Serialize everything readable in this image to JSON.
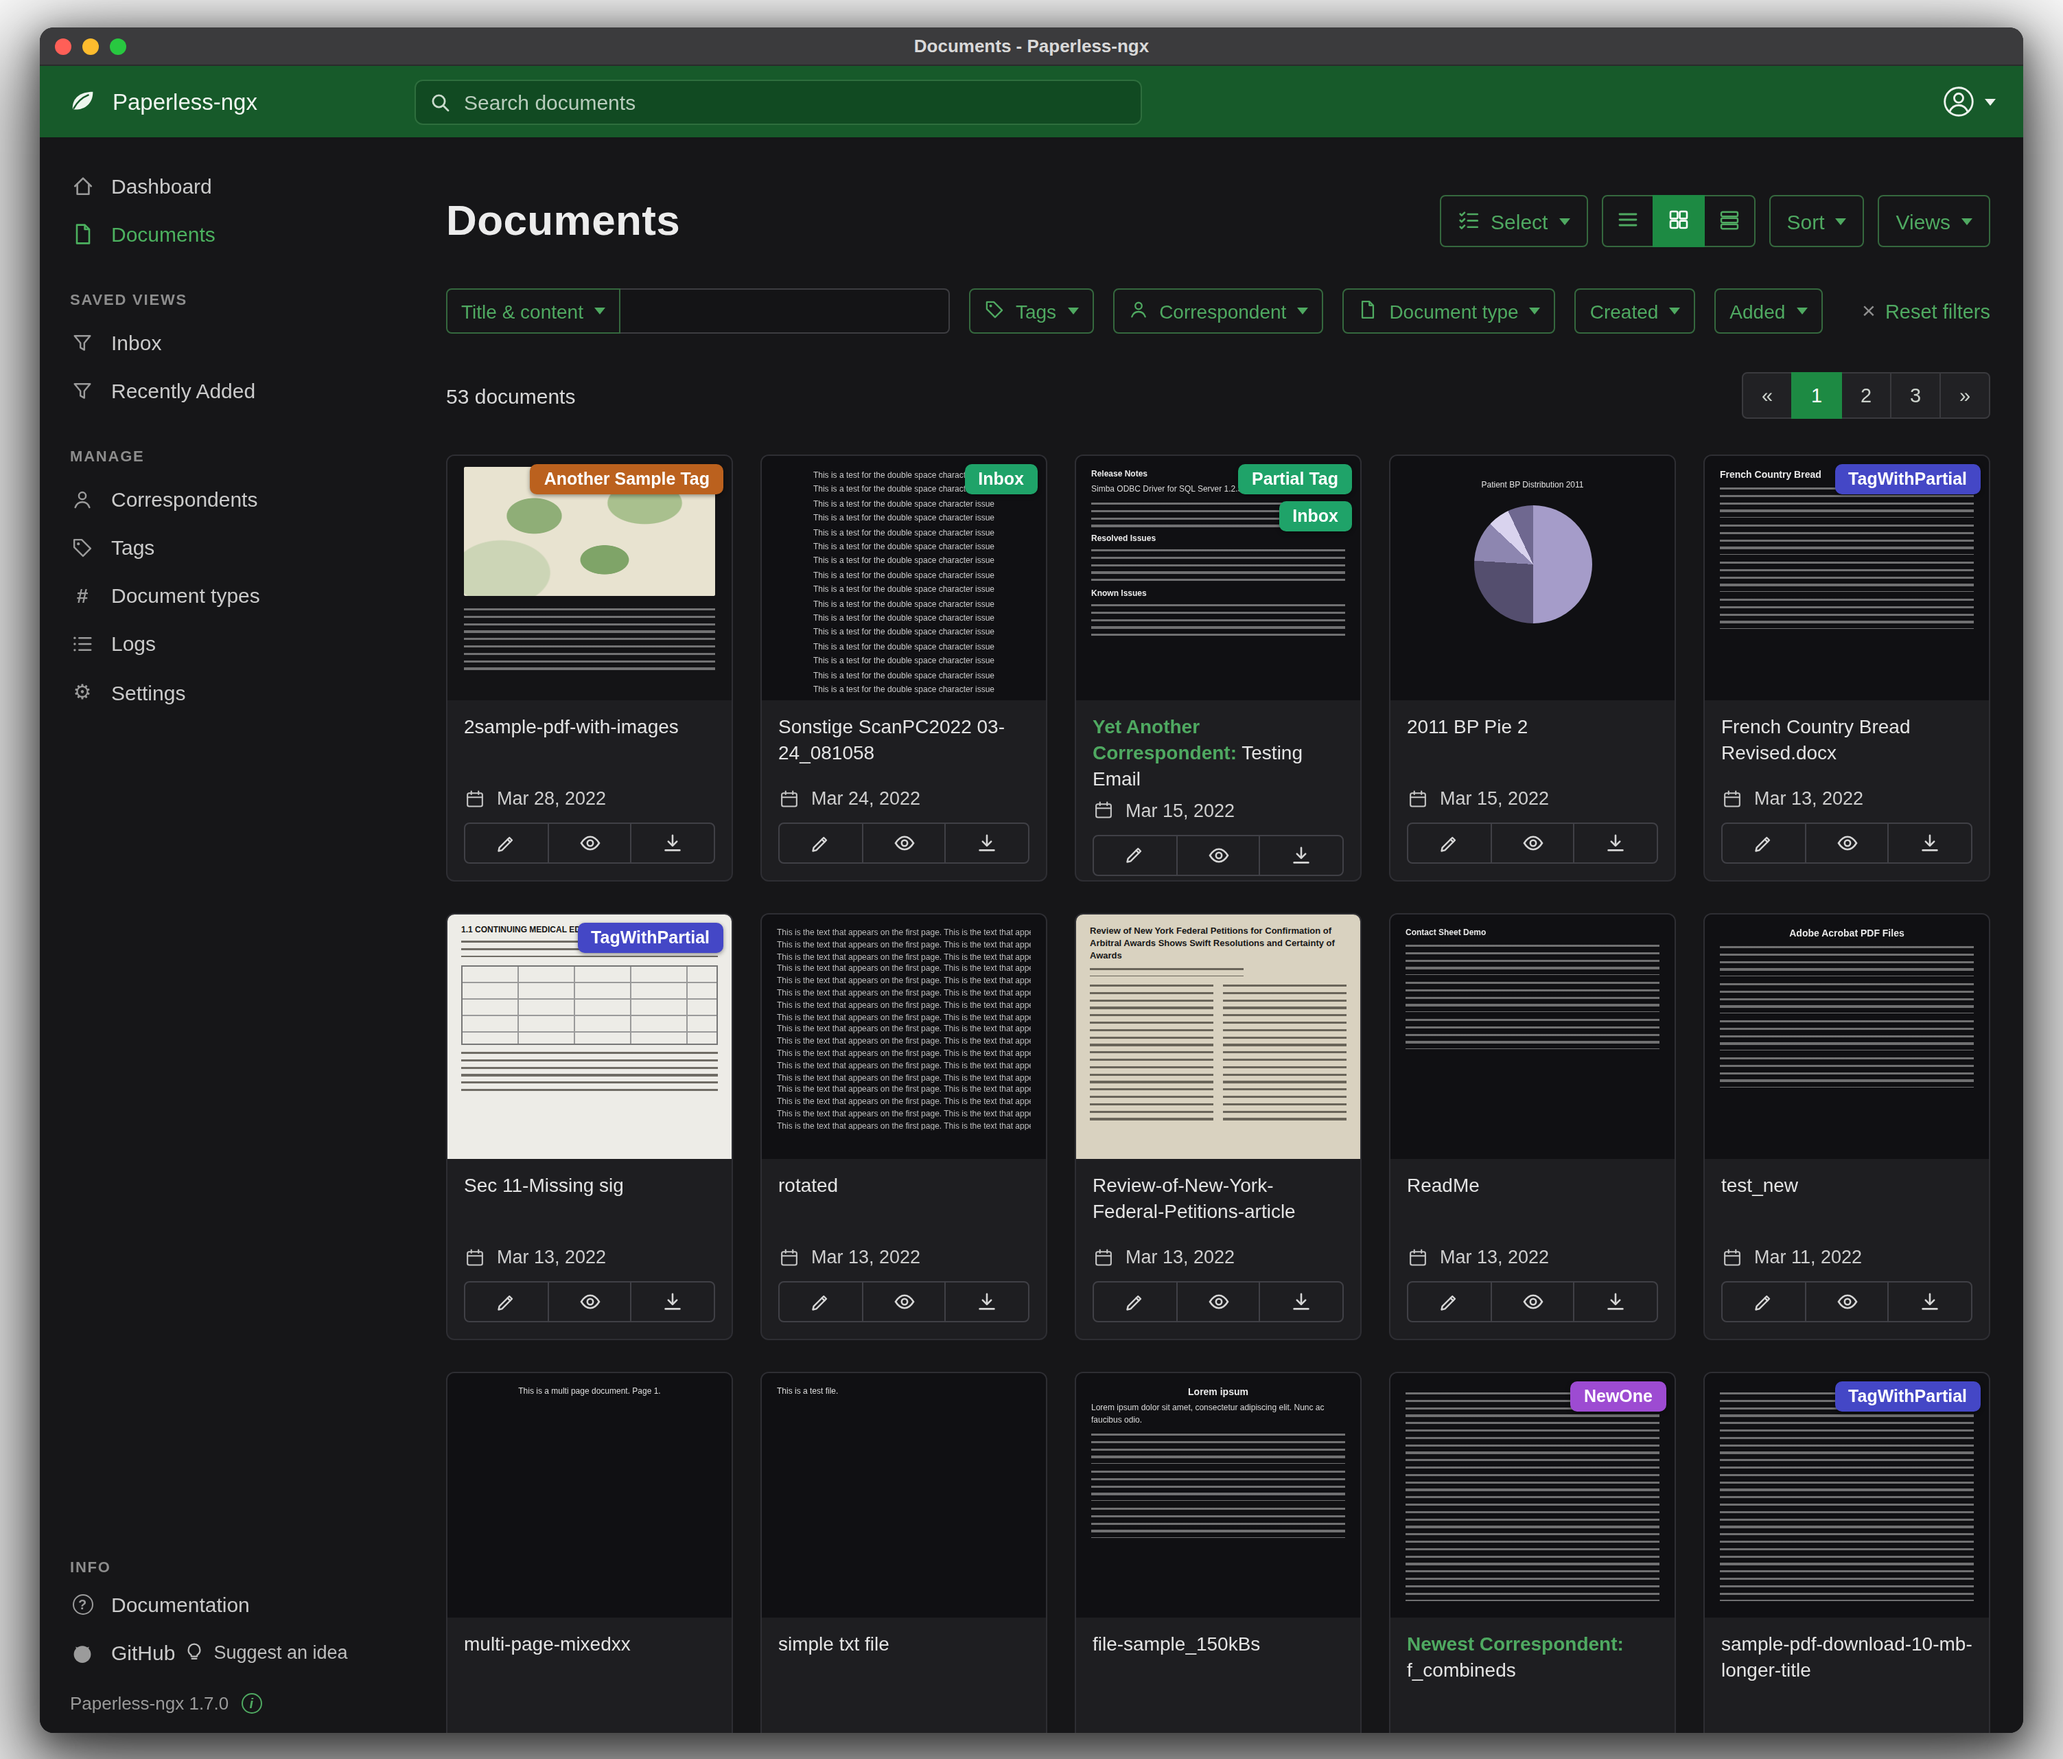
{
  "window": {
    "title": "Documents - Paperless-ngx"
  },
  "navbar": {
    "brand": "Paperless-ngx",
    "search_placeholder": "Search documents"
  },
  "sidebar": {
    "dashboard": "Dashboard",
    "documents": "Documents",
    "saved_views_title": "SAVED VIEWS",
    "inbox": "Inbox",
    "recently_added": "Recently Added",
    "manage_title": "MANAGE",
    "correspondents": "Correspondents",
    "tags": "Tags",
    "document_types": "Document types",
    "logs": "Logs",
    "settings": "Settings",
    "info_title": "INFO",
    "documentation": "Documentation",
    "github": "GitHub",
    "suggest": "Suggest an idea",
    "version": "Paperless-ngx 1.7.0"
  },
  "main": {
    "title": "Documents",
    "toolbar": {
      "select": "Select",
      "sort": "Sort",
      "views": "Views"
    },
    "filters": {
      "title_content": "Title & content",
      "tags": "Tags",
      "correspondent": "Correspondent",
      "document_type": "Document type",
      "created": "Created",
      "added": "Added",
      "reset": "Reset filters"
    },
    "count": "53 documents",
    "pagination": {
      "prev": "«",
      "pages": [
        "1",
        "2",
        "3"
      ],
      "next": "»",
      "active": "1"
    },
    "cards": [
      {
        "title": "2sample-pdf-with-images",
        "date": "Mar 28, 2022",
        "tags": [
          {
            "label": "Another Sample Tag",
            "color": "#bb611e"
          }
        ],
        "thumb": {
          "kind": "map"
        }
      },
      {
        "title": "Sonstige ScanPC2022 03-24_081058",
        "date": "Mar 24, 2022",
        "tags": [
          {
            "label": "Inbox",
            "color": "#1fa369"
          }
        ],
        "thumb": {
          "kind": "repeat",
          "text": "This is a test for the double space character issue",
          "count": 16,
          "align": "center"
        }
      },
      {
        "correspondent": "Yet Another Correspondent",
        "title": "Testing Email",
        "date": "Mar 15, 2022",
        "tags": [
          {
            "label": "Partial Tag",
            "color": "#1fa369"
          },
          {
            "label": "Inbox",
            "color": "#1fa369"
          }
        ],
        "thumb": {
          "kind": "doc",
          "heading": "Release Notes",
          "small": true,
          "sub": "Simba ODBC Driver for SQL Server 1.2.3",
          "sections": [
            "Resolved Issues",
            "Known Issues"
          ]
        }
      },
      {
        "title": "2011 BP Pie 2",
        "date": "Mar 15, 2022",
        "tags": [],
        "thumb": {
          "kind": "pie",
          "title": "Patient BP Distribution 2011"
        }
      },
      {
        "title": "French Country Bread Revised.docx",
        "date": "Mar 13, 2022",
        "tags": [
          {
            "label": "TagWithPartial",
            "color": "#4447c6"
          }
        ],
        "thumb": {
          "kind": "doc",
          "heading": "French Country Bread",
          "fuzz": 4
        }
      },
      {
        "title": "Sec 11-Missing sig",
        "date": "Mar 13, 2022",
        "tags": [
          {
            "label": "TagWithPartial",
            "color": "#4447c6"
          }
        ],
        "thumb": {
          "kind": "form",
          "heading": "1.1 CONTINUING MEDICAL EDUCA"
        }
      },
      {
        "title": "rotated",
        "date": "Mar 13, 2022",
        "tags": [],
        "thumb": {
          "kind": "repeat",
          "text": "This is the text that appears on the first page.",
          "count": 17,
          "align": "left",
          "dense": true
        }
      },
      {
        "title": "Review-of-New-York-Federal-Petitions-article",
        "date": "Mar 13, 2022",
        "tags": [],
        "thumb": {
          "kind": "article",
          "heading": "Review of New York Federal Petitions for Confirmation of Arbitral Awards Shows Swift Resolutions and Certainty of Awards"
        }
      },
      {
        "title": "ReadMe",
        "date": "Mar 13, 2022",
        "tags": [],
        "thumb": {
          "kind": "doc",
          "heading": "Contact Sheet Demo",
          "small": true,
          "fuzz": 3
        }
      },
      {
        "title": "test_new",
        "date": "Mar 11, 2022",
        "tags": [],
        "thumb": {
          "kind": "doc",
          "heading": "Adobe Acrobat PDF Files",
          "align": "center",
          "fuzz": 4
        }
      },
      {
        "title": "multi-page-mixedxx",
        "tags": [],
        "thumb": {
          "kind": "doc",
          "heading": "This is a multi page document. Page 1.",
          "tiny": true,
          "align": "center"
        }
      },
      {
        "title": "simple txt file",
        "tags": [],
        "thumb": {
          "kind": "doc",
          "heading": "This is a test file.",
          "tiny": true
        }
      },
      {
        "title": "file-sample_150kBs",
        "tags": [],
        "thumb": {
          "kind": "doc",
          "heading": "Lorem ipsum",
          "align": "center",
          "sub": "Lorem ipsum dolor sit amet, consectetur adipiscing elit. Nunc ac faucibus odio.",
          "fuzz": 3
        }
      },
      {
        "correspondent": "Newest Correspondent",
        "title": "f_combineds",
        "tags": [
          {
            "label": "NewOne",
            "color": "#9d4bd2"
          }
        ],
        "thumb": {
          "kind": "doc",
          "denseFuzz": true
        }
      },
      {
        "title": "sample-pdf-download-10-mb-longer-title",
        "tags": [
          {
            "label": "TagWithPartial",
            "color": "#4447c6"
          }
        ],
        "thumb": {
          "kind": "doc",
          "denseFuzz": true
        }
      }
    ]
  },
  "colors": {
    "accent": "#4fa961",
    "active_green": "#1d8a43",
    "navbar_green": "#175a2a"
  }
}
